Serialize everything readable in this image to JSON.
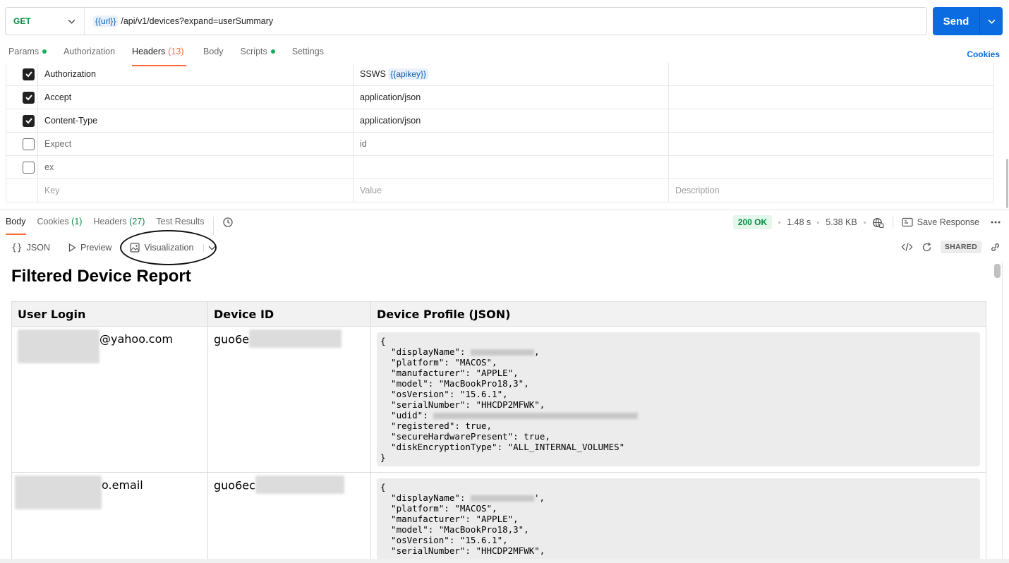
{
  "request": {
    "method": "GET",
    "url_var": "{{url}}",
    "url_path": "/api/v1/devices?expand=userSummary",
    "send_label": "Send"
  },
  "request_tabs": {
    "params": "Params",
    "authorization": "Authorization",
    "headers": "Headers",
    "headers_count": "(13)",
    "body": "Body",
    "scripts": "Scripts",
    "settings": "Settings",
    "cookies": "Cookies"
  },
  "headers": [
    {
      "checked": true,
      "key": "Authorization",
      "value_prefix": "SSWS",
      "value_var": "{{apikey}}"
    },
    {
      "checked": true,
      "key": "Accept",
      "value": "application/json"
    },
    {
      "checked": true,
      "key": "Content-Type",
      "value": "application/json"
    },
    {
      "checked": false,
      "key": "Expect",
      "value": "id"
    },
    {
      "checked": false,
      "key": "ex",
      "value": ""
    }
  ],
  "headers_placeholder": {
    "key": "Key",
    "value": "Value",
    "description": "Description"
  },
  "response_tabs": {
    "body": "Body",
    "cookies": "Cookies",
    "cookies_count": "(1)",
    "headers": "Headers",
    "headers_count": "(27)",
    "test_results": "Test Results"
  },
  "response_meta": {
    "status": "200 OK",
    "time": "1.48 s",
    "size": "5.38 KB",
    "save_response": "Save Response"
  },
  "view": {
    "json": "JSON",
    "preview": "Preview",
    "visualization": "Visualization",
    "shared": "SHARED"
  },
  "report": {
    "title": "Filtered Device Report",
    "columns": [
      "User Login",
      "Device ID",
      "Device Profile (JSON)"
    ],
    "rows": [
      {
        "login_suffix": "@yahoo.com",
        "device_prefix": "guo6e",
        "json_lines": [
          "{",
          "  \"displayName\": ",
          "  \"platform\": \"MACOS\",",
          "  \"manufacturer\": \"APPLE\",",
          "  \"model\": \"MacBookPro18,3\",",
          "  \"osVersion\": \"15.6.1\",",
          "  \"serialNumber\": \"HHCDP2MFWK\",",
          "  \"udid\": ",
          "  \"registered\": true,",
          "  \"secureHardwarePresent\": true,",
          "  \"diskEncryptionType\": \"ALL_INTERNAL_VOLUMES\"",
          "}"
        ]
      },
      {
        "login_suffix": "o.email",
        "device_prefix": "guo6ec",
        "json_lines": [
          "{",
          "  \"displayName\": ",
          "  \"platform\": \"MACOS\",",
          "  \"manufacturer\": \"APPLE\",",
          "  \"model\": \"MacBookPro18,3\",",
          "  \"osVersion\": \"15.6.1\",",
          "  \"serialNumber\": \"HHCDP2MFWK\","
        ]
      }
    ]
  }
}
